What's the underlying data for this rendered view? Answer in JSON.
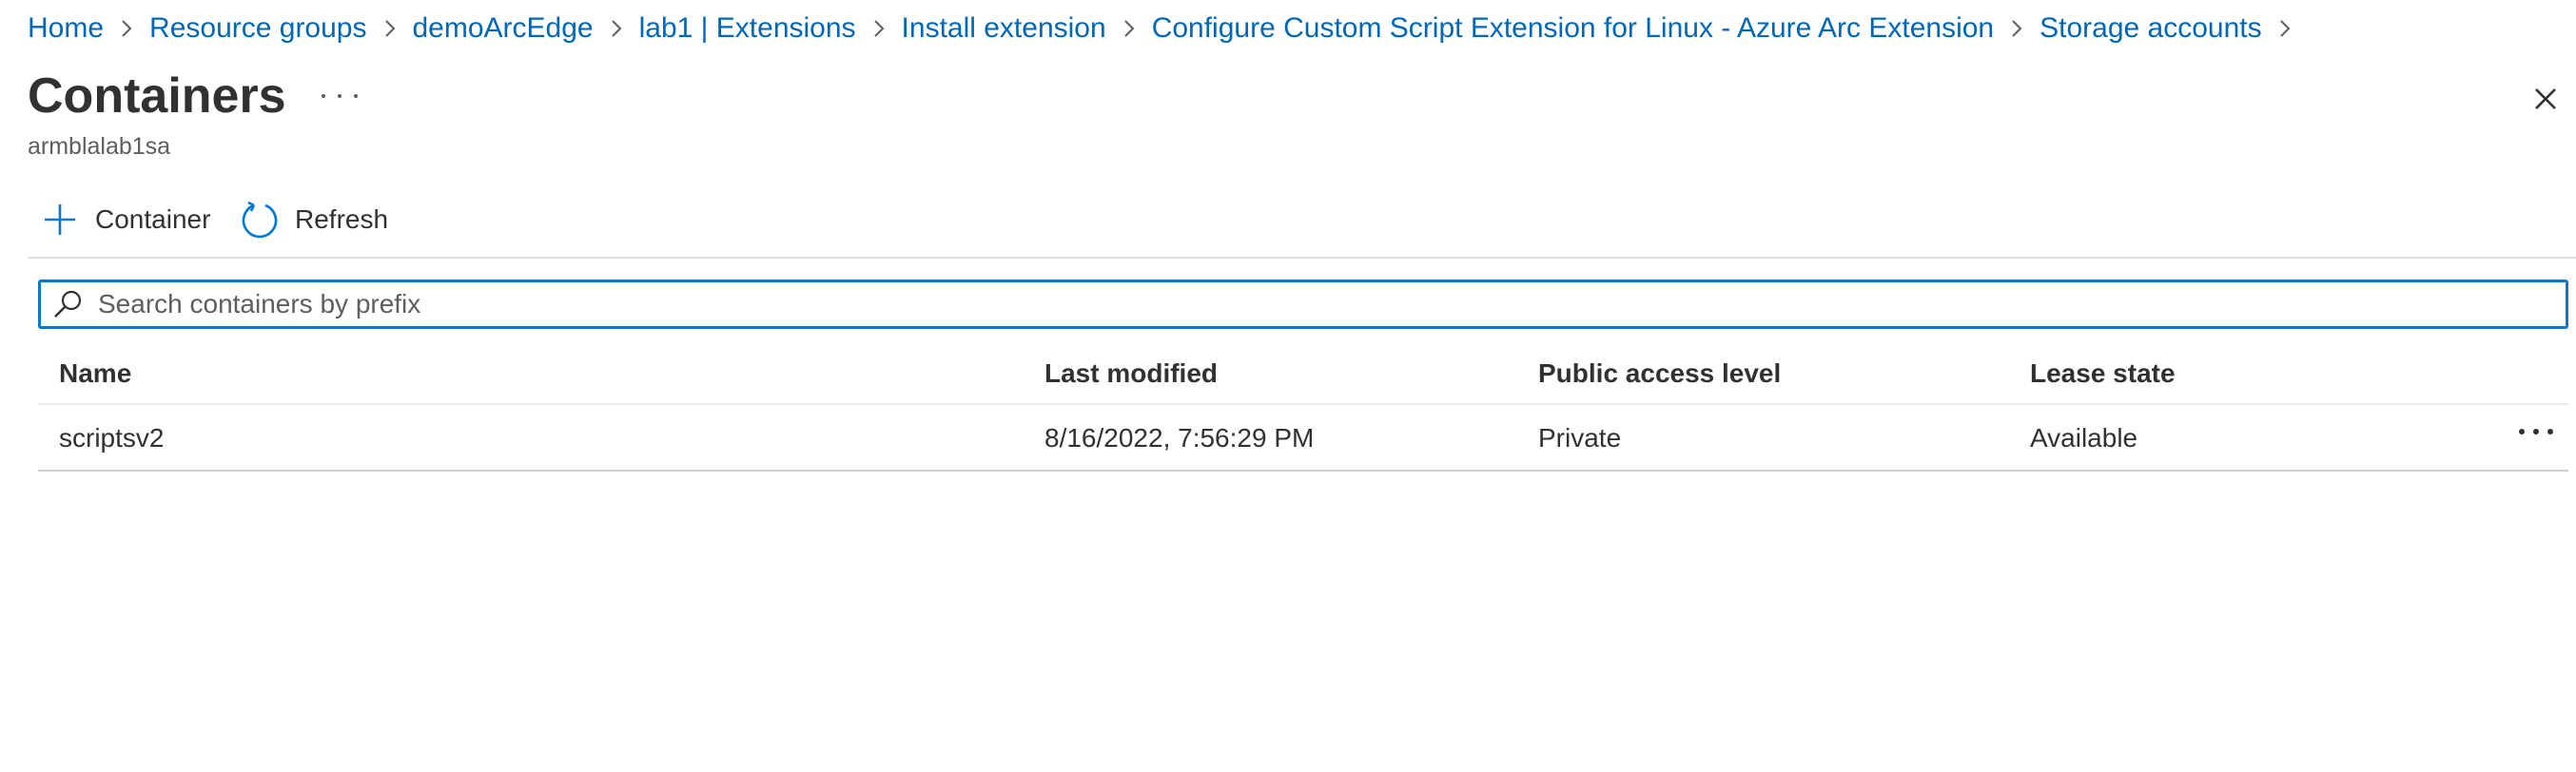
{
  "breadcrumb": {
    "items": [
      "Home",
      "Resource groups",
      "demoArcEdge",
      "lab1 | Extensions",
      "Install extension",
      "Configure Custom Script Extension for Linux - Azure Arc Extension",
      "Storage accounts"
    ]
  },
  "header": {
    "title": "Containers",
    "subtitle": "armblalab1sa",
    "more_icon": "ellipsis-icon",
    "close_icon": "close-icon"
  },
  "toolbar": {
    "add_label": "Container",
    "add_icon": "plus-icon",
    "refresh_label": "Refresh",
    "refresh_icon": "refresh-icon"
  },
  "search": {
    "placeholder": "Search containers by prefix",
    "value": "",
    "icon": "search-icon"
  },
  "table": {
    "columns": [
      "Name",
      "Last modified",
      "Public access level",
      "Lease state"
    ],
    "rows": [
      {
        "name": "scriptsv2",
        "last_modified": "8/16/2022, 7:56:29 PM",
        "public_access_level": "Private",
        "lease_state": "Available"
      }
    ]
  },
  "colors": {
    "accent": "#0078d4",
    "link": "#0067b8",
    "text": "#323130"
  }
}
